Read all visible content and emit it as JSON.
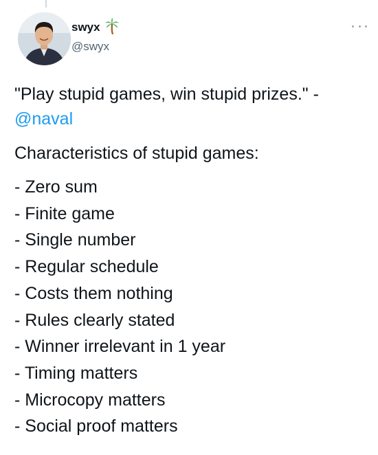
{
  "author": {
    "display_name": "swyx",
    "handle": "@swyx",
    "badge_icon": "palm-tree-icon"
  },
  "tweet": {
    "quote": "\"Play stupid games, win stupid prizes.\" -",
    "mention": "@naval",
    "heading": "Characteristics of stupid games:",
    "bullets": [
      "- Zero sum",
      "- Finite game",
      "- Single number",
      "- Regular schedule",
      "- Costs them nothing",
      "- Rules clearly stated",
      "- Winner irrelevant in 1 year",
      "- Timing matters",
      "- Microcopy matters",
      "- Social proof matters"
    ]
  },
  "colors": {
    "text": "#0f1419",
    "secondary": "#536471",
    "link": "#1d9bf0"
  }
}
